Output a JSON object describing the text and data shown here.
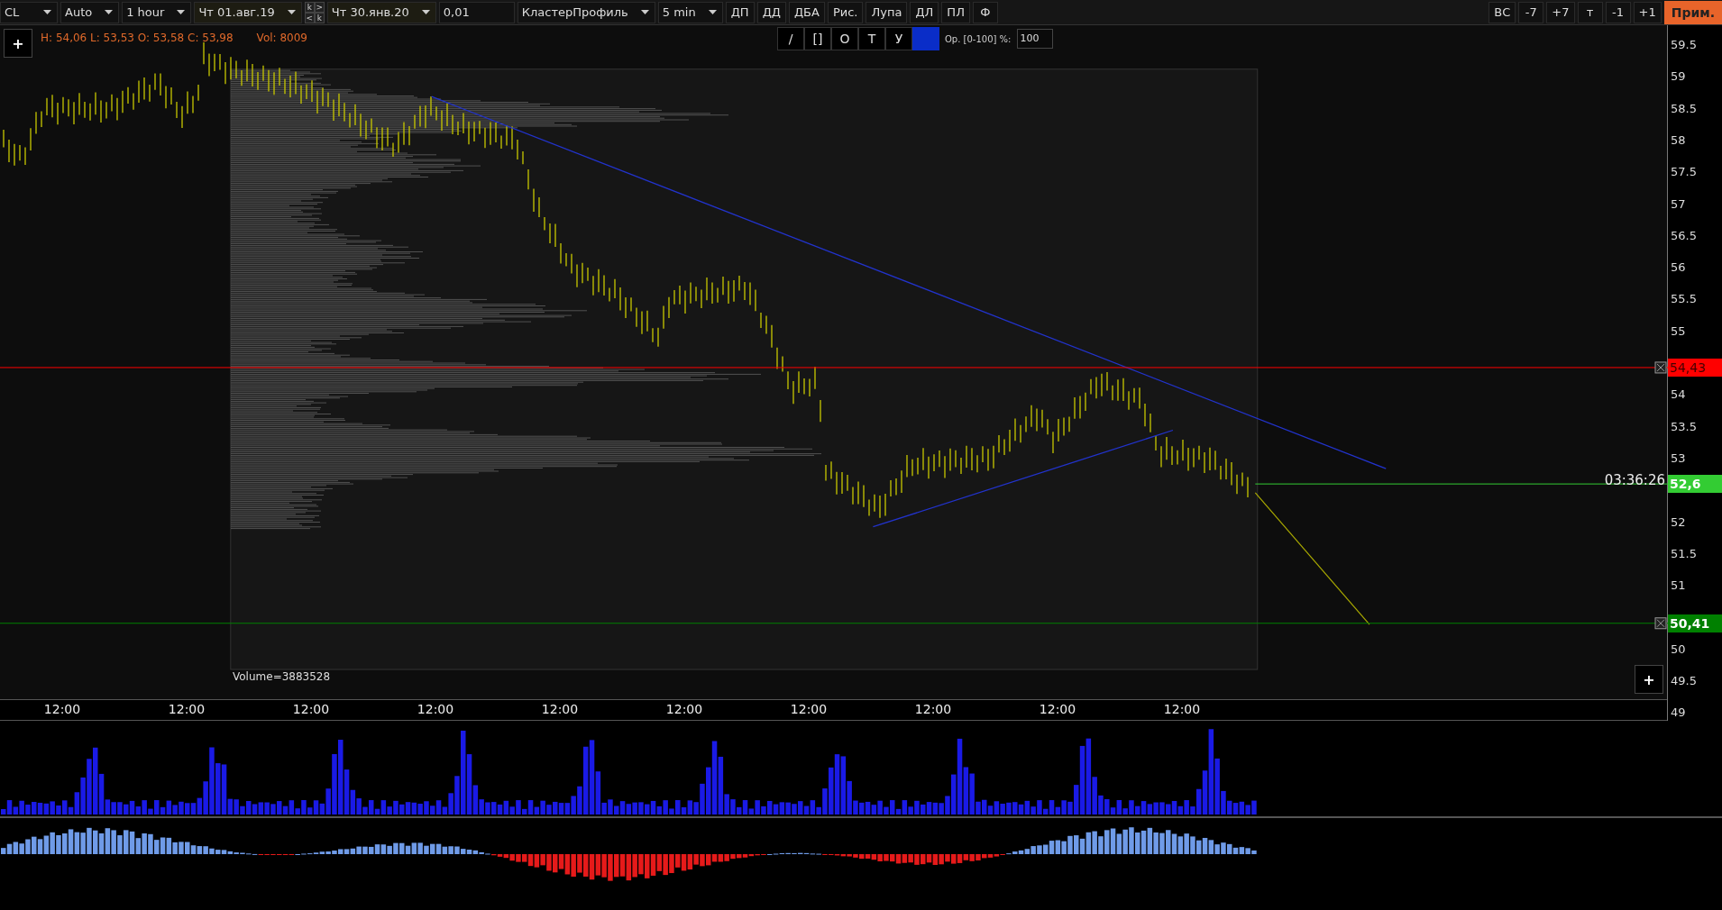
{
  "toolbar": {
    "left": [
      {
        "kind": "dropdown",
        "value": "CL"
      },
      {
        "kind": "dropdown",
        "value": "Auto"
      },
      {
        "kind": "dropdown",
        "value": "1 hour"
      },
      {
        "kind": "date",
        "value": "Чт 01.авг.19"
      },
      {
        "kind": "stepper",
        "labels": [
          "k",
          ">",
          "<",
          "k"
        ]
      },
      {
        "kind": "date",
        "value": "Чт 30.янв.20"
      },
      {
        "kind": "input",
        "value": "0,01"
      },
      {
        "kind": "dropdown",
        "value": "КластерПрофиль"
      },
      {
        "kind": "dropdown",
        "value": "5 min"
      },
      {
        "kind": "button",
        "value": "ДП"
      },
      {
        "kind": "button",
        "value": "ДД"
      },
      {
        "kind": "button",
        "value": "ДБА"
      },
      {
        "kind": "button",
        "value": "Рис."
      },
      {
        "kind": "button",
        "value": "Лупа"
      },
      {
        "kind": "button",
        "value": "ДЛ"
      },
      {
        "kind": "button",
        "value": "ПЛ"
      },
      {
        "kind": "button",
        "value": "Ф"
      }
    ],
    "right": [
      {
        "kind": "button",
        "value": "ВС"
      },
      {
        "kind": "button",
        "value": "-7"
      },
      {
        "kind": "button",
        "value": "+7"
      },
      {
        "kind": "button",
        "value": "т"
      },
      {
        "kind": "button",
        "value": "-1"
      },
      {
        "kind": "button",
        "value": "+1"
      },
      {
        "kind": "accent",
        "value": "Прим."
      }
    ]
  },
  "chart": {
    "add_button": "+",
    "ohlc": "H: 54,06 L: 53,53 O: 53,58 C: 53,98",
    "vol": "Vol: 8009",
    "drawing_tools": {
      "buttons": [
        "/",
        "[]",
        "O",
        "T",
        "У"
      ],
      "color": "#0a2dc8",
      "opacity_label": "Ор. [0-100] %:",
      "opacity_value": "100"
    },
    "timer": "03:36:26",
    "volume_label": "Volume=3883528",
    "corner_button": "+",
    "price_axis": [
      "59.5",
      "59",
      "58.5",
      "58",
      "57.5",
      "57",
      "56.5",
      "56",
      "55.5",
      "55",
      "54",
      "53.5",
      "53",
      "52",
      "51.5",
      "51",
      "50",
      "49.5",
      "49"
    ],
    "price_marks": [
      {
        "value": "54,43",
        "color": "#ff0000",
        "closable": true
      },
      {
        "value": "52,6",
        "color": "#33cc33",
        "closable": false
      },
      {
        "value": "50,41",
        "color": "#008000",
        "closable": true
      }
    ],
    "time_axis": [
      "12:00",
      "12:00",
      "12:00",
      "12:00",
      "12:00",
      "12:00",
      "12:00",
      "12:00",
      "12:00",
      "12:00"
    ]
  }
}
